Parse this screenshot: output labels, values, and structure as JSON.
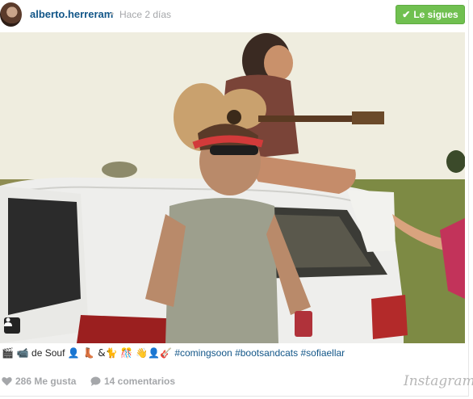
{
  "header": {
    "username": "alberto.herreram",
    "separator": "•",
    "time": "Hace 2 días",
    "follow_label": "Le sigues",
    "follow_icon": "check-icon"
  },
  "photo": {
    "subject": "photo-post",
    "user_tag_icon": "user-tag-icon"
  },
  "caption": {
    "prefix_emoji": "🎬 📹",
    "text_by": "de Souf",
    "emoji_run": "👤 👢 &🐈 🎊 👋👤🎸",
    "hashtags": [
      "#comingsoon",
      "#bootsandcats",
      "#sofiaellar"
    ]
  },
  "footer": {
    "likes": "286 Me gusta",
    "comments": "14 comentarios",
    "brand": "Instagram"
  },
  "colors": {
    "link": "#125688",
    "follow_green": "#70c050",
    "muted": "#a5a7aa"
  }
}
